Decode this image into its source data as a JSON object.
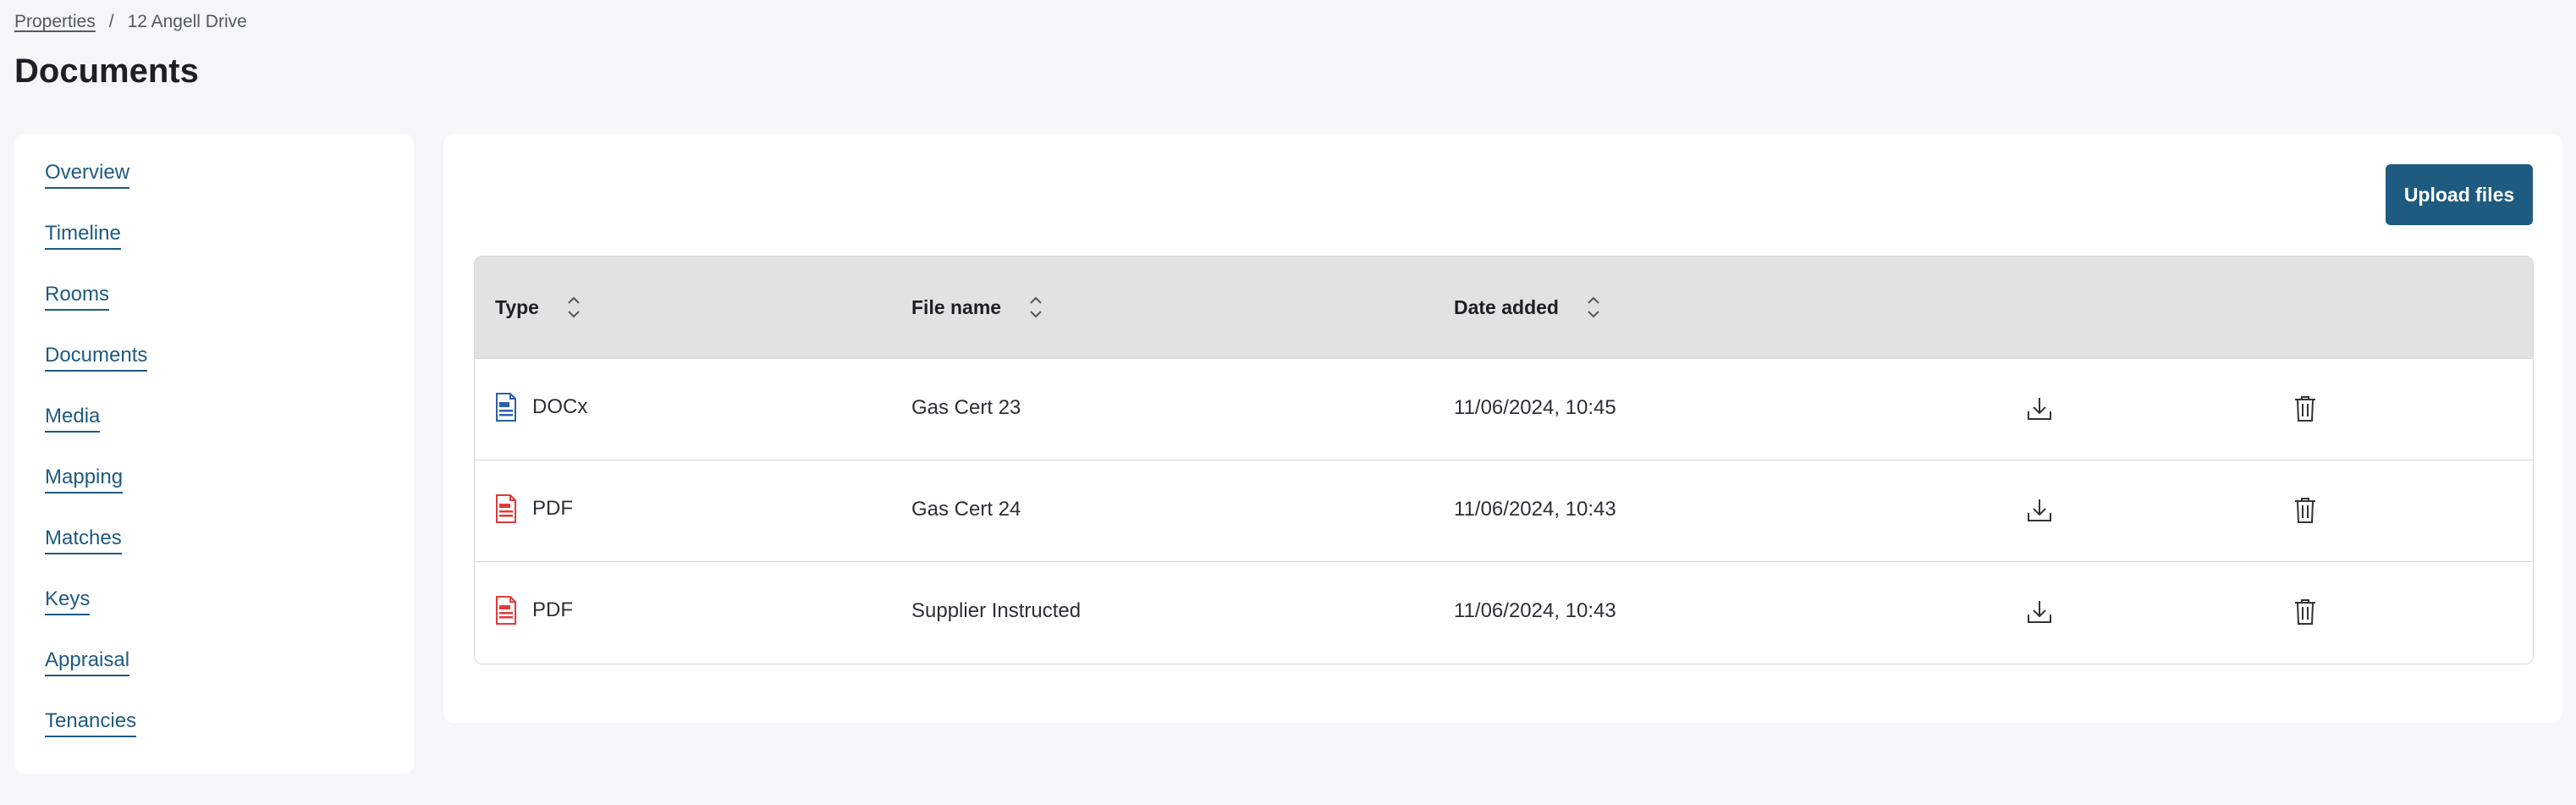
{
  "breadcrumb": {
    "parent": "Properties",
    "separator": "/",
    "current": "12 Angell Drive"
  },
  "page_title": "Documents",
  "sidebar": {
    "items": [
      {
        "label": "Overview"
      },
      {
        "label": "Timeline"
      },
      {
        "label": "Rooms"
      },
      {
        "label": "Documents"
      },
      {
        "label": "Media"
      },
      {
        "label": "Mapping"
      },
      {
        "label": "Matches"
      },
      {
        "label": "Keys"
      },
      {
        "label": "Appraisal"
      },
      {
        "label": "Tenancies"
      }
    ]
  },
  "toolbar": {
    "upload_label": "Upload files"
  },
  "table": {
    "columns": [
      {
        "label": "Type",
        "sortable": true
      },
      {
        "label": "File name",
        "sortable": true
      },
      {
        "label": "Date added",
        "sortable": true
      }
    ],
    "rows": [
      {
        "type": "DOCx",
        "icon": "docx-file-icon",
        "file_name": "Gas Cert 23",
        "date_added": "11/06/2024, 10:45"
      },
      {
        "type": "PDF",
        "icon": "pdf-file-icon",
        "file_name": "Gas Cert 24",
        "date_added": "11/06/2024, 10:43"
      },
      {
        "type": "PDF",
        "icon": "pdf-file-icon",
        "file_name": "Supplier Instructed",
        "date_added": "11/06/2024, 10:43"
      }
    ],
    "row_actions": [
      "download-icon",
      "trash-icon"
    ]
  },
  "colors": {
    "accent": "#1f5a80",
    "docx_icon": "#2f5fa8",
    "pdf_icon": "#e03a3a",
    "header_bg": "#e2e2e2",
    "page_bg": "#f4f6f7"
  }
}
